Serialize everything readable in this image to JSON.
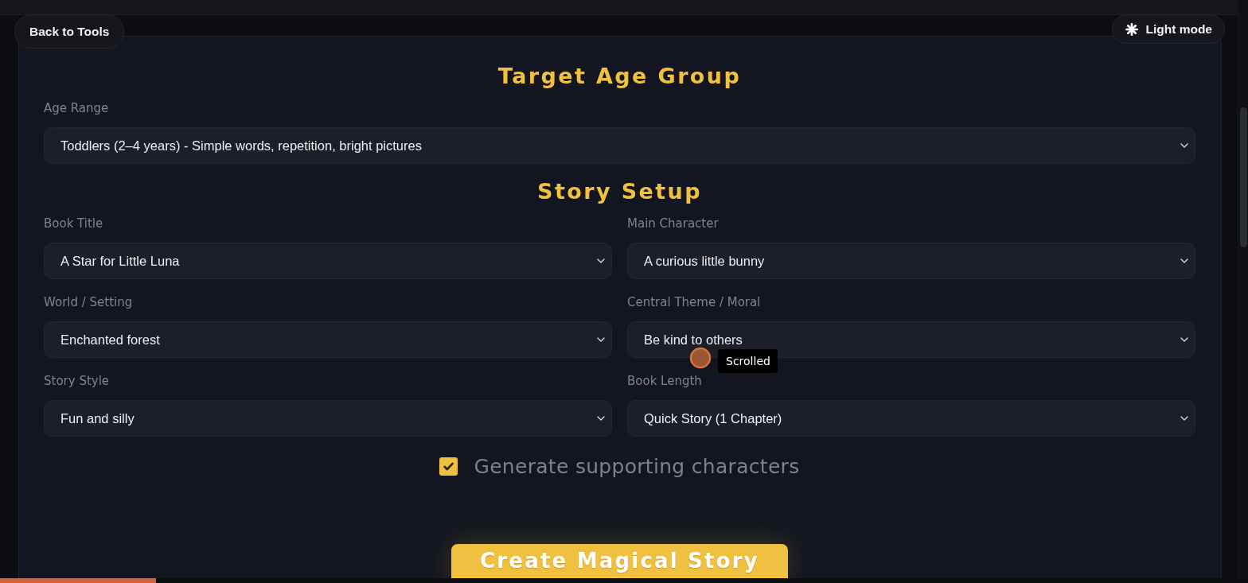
{
  "top_bar": {
    "back_button": "Back to Tools",
    "theme_toggle": "Light mode"
  },
  "sections": [
    {
      "title": "Target Age Group",
      "fields": [
        {
          "label": "Age Range",
          "value": "Toddlers (2–4 years) - Simple words, repetition, bright pictures"
        }
      ]
    },
    {
      "title": "Story Setup",
      "fields": [
        {
          "label": "Book Title",
          "value": "A Star for Little Luna"
        },
        {
          "label": "Main Character",
          "value": "A curious little bunny"
        },
        {
          "label": "World / Setting",
          "value": "Enchanted forest"
        },
        {
          "label": "Central Theme / Moral",
          "value": "Be kind to others"
        },
        {
          "label": "Story Style",
          "value": "Fun and silly"
        },
        {
          "label": "Book Length",
          "value": "Quick Story (1 Chapter)"
        }
      ]
    }
  ],
  "options": [
    {
      "label": "Generate supporting characters",
      "checked": true
    }
  ],
  "submit_button": "Create Magical Story",
  "cursor_tooltip": "Scrolled",
  "page_progress": {
    "level": 0.125
  }
}
